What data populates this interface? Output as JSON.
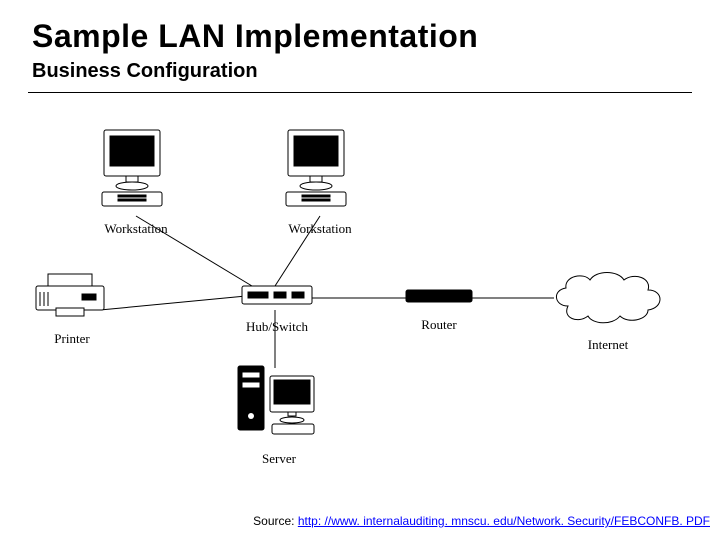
{
  "title": "Sample LAN Implementation",
  "subtitle": "Business Configuration",
  "nodes": {
    "ws1": "Workstation",
    "ws2": "Workstation",
    "printer": "Printer",
    "hub": "Hub/Switch",
    "router": "Router",
    "internet": "Internet",
    "server": "Server"
  },
  "source_label": "Source: ",
  "source_link_text": "http: //www. internalauditing. mnscu. edu/Network. Security/FEBCONFB. PDF"
}
